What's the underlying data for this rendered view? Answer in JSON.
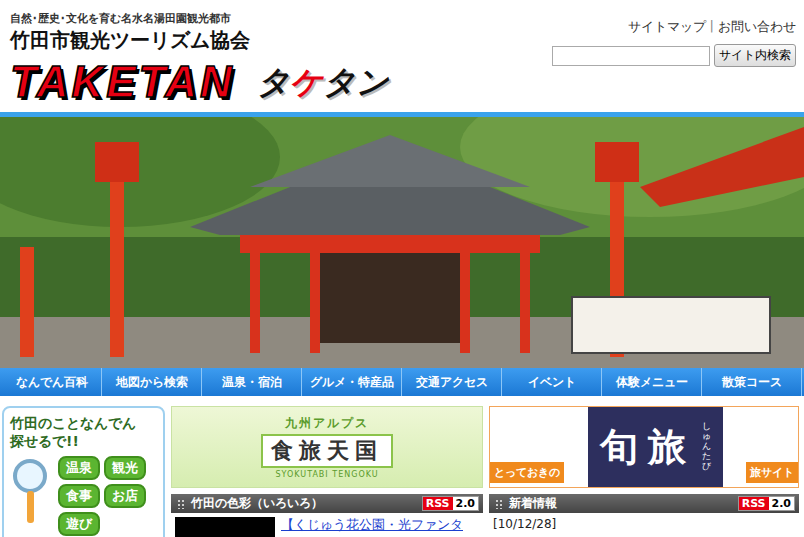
{
  "header": {
    "tagline": "自然･歴史･文化を育む名水名湯田園観光都市",
    "org": "竹田市観光ツーリズム協会",
    "logo_text": "TAKETAN",
    "logo_kana": [
      {
        "text": "タ",
        "color": "#111111"
      },
      {
        "text": "ケ",
        "color": "#e60012"
      },
      {
        "text": "タン",
        "color": "#111111"
      }
    ]
  },
  "top_links": [
    "サイトマップ",
    "お問い合わせ"
  ],
  "top_link_separator": "|",
  "search": {
    "button": "サイト内検索"
  },
  "nav": [
    "なんでん百科",
    "地図から検索",
    "温泉・宿泊",
    "グルメ・特産品",
    "交通アクセス",
    "イベント",
    "体験メニュー",
    "散策コース"
  ],
  "finder": {
    "title_lines": [
      "竹田のことなんでん",
      "探せるで!!"
    ],
    "buttons": [
      "温泉",
      "観光",
      "食事",
      "お店",
      "遊び"
    ]
  },
  "banner_shokutabi": {
    "over": "九州アルプス",
    "main": "食旅天国",
    "sub": "SYOKUTABI TENGOKU"
  },
  "banner_shuntabi": {
    "left": "とっておきの",
    "title": "旬旅",
    "reading": "しゅんたび",
    "right": "旅サイト"
  },
  "panels": [
    {
      "title": "竹田の色彩（いろいろ）",
      "rss": [
        "RSS",
        "2.0"
      ],
      "items": [
        {
          "kind": "link",
          "text": "【くじゅう花公園・光ファンタ"
        }
      ]
    },
    {
      "title": "新着情報",
      "rss": [
        "RSS",
        "2.0"
      ],
      "items": [
        {
          "kind": "date",
          "text": "[10/12/28]"
        }
      ]
    }
  ]
}
